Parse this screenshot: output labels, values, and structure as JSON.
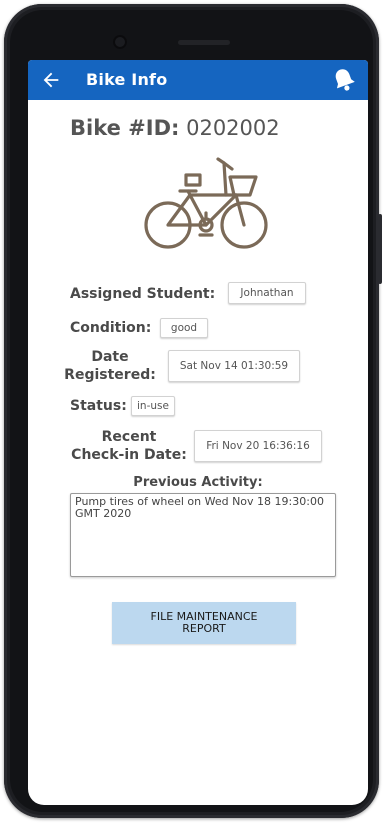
{
  "app": {
    "title": "Bike Info",
    "back_icon": "back-arrow-icon",
    "bell_icon": "bell-icon",
    "bar_color": "#1565c0"
  },
  "bike": {
    "id_label": "Bike #ID:",
    "id_value": "0202002",
    "image_icon": "bicycle-icon"
  },
  "fields": {
    "assigned_student_label": "Assigned Student:",
    "assigned_student_value": "Johnathan",
    "condition_label": "Condition:",
    "condition_value": "good",
    "date_registered_label_1": "Date",
    "date_registered_label_2": "Registered:",
    "date_registered_value": "Sat Nov 14 01:30:59",
    "status_label": "Status:",
    "status_value": "in-use",
    "recent_checkin_label_1": "Recent",
    "recent_checkin_label_2": "Check-in Date:",
    "recent_checkin_value": "Fri Nov 20 16:36:16"
  },
  "previous_activity": {
    "label": "Previous Activity:",
    "text": "Pump tires of wheel on Wed Nov 18 19:30:00 GMT 2020"
  },
  "actions": {
    "file_report_line1": "FILE MAINTENANCE",
    "file_report_line2": "REPORT",
    "button_color": "#bcd8ef"
  }
}
